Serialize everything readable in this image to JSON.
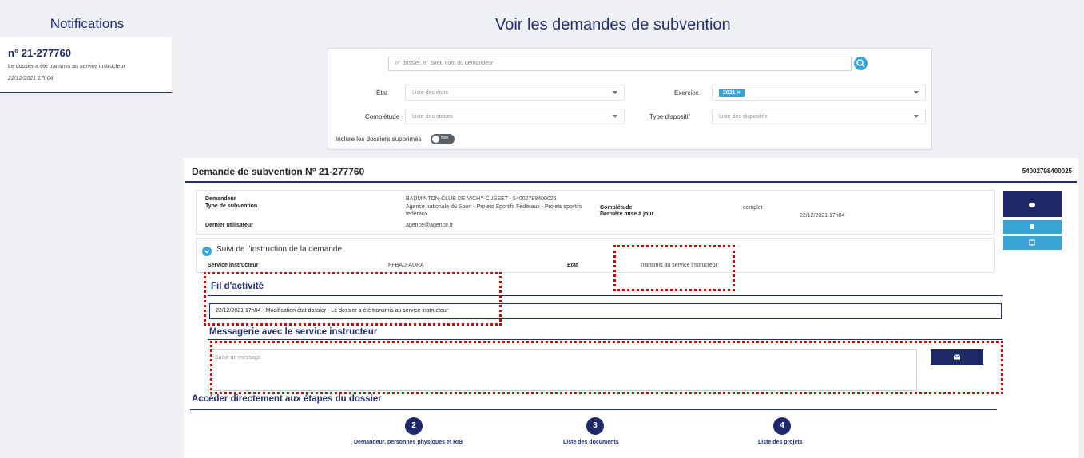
{
  "sidebar": {
    "title": "Notifications",
    "notification": {
      "number": "n° 21-277760",
      "message": "Le dossier a été transmis au service instructeur",
      "date": "22/12/2021 17h04"
    }
  },
  "page": {
    "title": "Voir les demandes de subvention"
  },
  "filters": {
    "search_placeholder": "n° dossier, n° Siret, nom du demandeur",
    "etat_label": "État",
    "etat_placeholder": "Liste des états",
    "exercice_label": "Exercice",
    "exercice_chip": "2021 ×",
    "completude_label": "Complétude",
    "completude_placeholder": "Liste des statuts",
    "type_label": "Type dispositif",
    "type_placeholder": "Liste des dispositifs",
    "include_deleted_label": "Inclure les dossiers supprimés",
    "toggle_label": "Non",
    "toggle_on": false
  },
  "request": {
    "title": "Demande de subvention N° 21-277760",
    "siret": "54002798400025",
    "fields": {
      "demandeur_label": "Demandeur",
      "demandeur_value": "BADMINTON-CLUB DE VICHY-CUSSET - 54002798400025",
      "type_label": "Type de subvention",
      "type_value": "Agence nationale du Sport - Projets Sportifs Fédéraux - Projets sportifs fédéraux",
      "utilisateur_label": "Dernier utilisateur",
      "utilisateur_value": "agence@agence.fr",
      "completude_label": "Complétude",
      "completude_value": "complet",
      "maj_label": "Dernière mise à jour",
      "maj_value": "22/12/2021 17h04"
    },
    "suivi": {
      "title": "Suivi de l'instruction de la demande",
      "service_label": "Service instructeur",
      "service_value": "FFBAD-AURA",
      "etat_label": "Etat",
      "etat_value": "Transmis au service instructeur"
    },
    "activity": {
      "title": "Fil d'activité",
      "entry": "22/12/2021 17h04  - Modification état dossier - Le dossier a été transmis au service instructeur"
    },
    "messaging": {
      "title": "Messagerie avec le service instructeur",
      "placeholder": "Saisir un message"
    }
  },
  "steps": {
    "title": "Accéder directement aux étapes du dossier",
    "items": [
      {
        "number": "2",
        "label": "Demandeur, personnes physiques et RIB"
      },
      {
        "number": "3",
        "label": "Liste des documents"
      },
      {
        "number": "4",
        "label": "Liste des projets"
      }
    ]
  },
  "colors": {
    "navy": "#1c2867",
    "accent": "#3aa3d6",
    "highlight": "#d10000"
  }
}
